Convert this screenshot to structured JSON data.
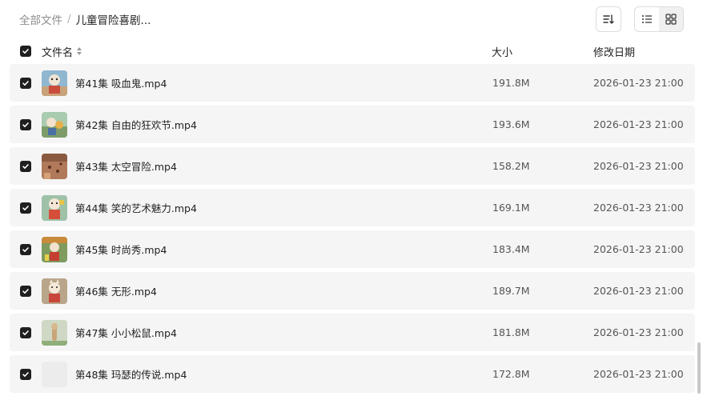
{
  "breadcrumb": {
    "root": "全部文件",
    "separator": "/",
    "current": "儿童冒险喜剧..."
  },
  "toolbar": {
    "sort_icon": "sort-icon",
    "list_view_icon": "list-view-icon",
    "grid_view_icon": "grid-view-icon",
    "active_view": "list"
  },
  "columns": {
    "name": "文件名",
    "size": "大小",
    "modified": "修改日期"
  },
  "files": [
    {
      "name": "第41集 吸血鬼.mp4",
      "size": "191.8M",
      "date": "2026-01-23 21:00",
      "thumb": "a"
    },
    {
      "name": "第42集 自由的狂欢节.mp4",
      "size": "193.6M",
      "date": "2026-01-23 21:00",
      "thumb": "b"
    },
    {
      "name": "第43集 太空冒险.mp4",
      "size": "158.2M",
      "date": "2026-01-23 21:00",
      "thumb": "c"
    },
    {
      "name": "第44集 笑的艺术魅力.mp4",
      "size": "169.1M",
      "date": "2026-01-23 21:00",
      "thumb": "d"
    },
    {
      "name": "第45集 时尚秀.mp4",
      "size": "183.4M",
      "date": "2026-01-23 21:00",
      "thumb": "e"
    },
    {
      "name": "第46集 无形.mp4",
      "size": "189.7M",
      "date": "2026-01-23 21:00",
      "thumb": "f"
    },
    {
      "name": "第47集 小小松鼠.mp4",
      "size": "181.8M",
      "date": "2026-01-23 21:00",
      "thumb": "g"
    },
    {
      "name": "第48集 玛瑟的传说.mp4",
      "size": "172.8M",
      "date": "2026-01-23 21:00",
      "thumb": ""
    }
  ]
}
